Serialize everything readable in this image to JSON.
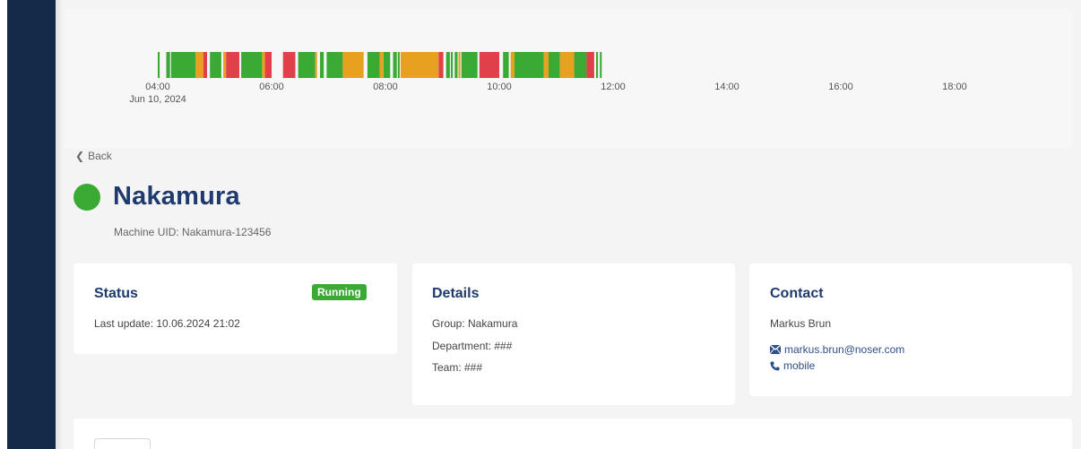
{
  "timeline": {
    "colors": {
      "green": "#3aaa35",
      "orange": "#e8a020",
      "red": "#e0404a"
    },
    "segments": [
      {
        "start": "04:00",
        "end": "04:02",
        "state": "green"
      },
      {
        "start": "04:09",
        "end": "04:13",
        "state": "green"
      },
      {
        "start": "04:14",
        "end": "04:40",
        "state": "green"
      },
      {
        "start": "04:40",
        "end": "04:48",
        "state": "orange"
      },
      {
        "start": "04:48",
        "end": "04:52",
        "state": "red"
      },
      {
        "start": "04:55",
        "end": "05:07",
        "state": "green"
      },
      {
        "start": "05:09",
        "end": "05:12",
        "state": "orange"
      },
      {
        "start": "05:12",
        "end": "05:26",
        "state": "red"
      },
      {
        "start": "05:28",
        "end": "05:50",
        "state": "green"
      },
      {
        "start": "05:50",
        "end": "05:53",
        "state": "orange"
      },
      {
        "start": "05:53",
        "end": "06:00",
        "state": "red"
      },
      {
        "start": "06:12",
        "end": "06:25",
        "state": "red"
      },
      {
        "start": "06:28",
        "end": "06:46",
        "state": "green"
      },
      {
        "start": "06:46",
        "end": "06:47",
        "state": "orange"
      },
      {
        "start": "06:51",
        "end": "06:55",
        "state": "green"
      },
      {
        "start": "06:58",
        "end": "07:15",
        "state": "green"
      },
      {
        "start": "07:15",
        "end": "07:37",
        "state": "orange"
      },
      {
        "start": "07:41",
        "end": "07:54",
        "state": "green"
      },
      {
        "start": "07:54",
        "end": "07:58",
        "state": "orange"
      },
      {
        "start": "07:58",
        "end": "08:05",
        "state": "green"
      },
      {
        "start": "08:08",
        "end": "08:12",
        "state": "green"
      },
      {
        "start": "08:13",
        "end": "08:15",
        "state": "green"
      },
      {
        "start": "08:16",
        "end": "08:56",
        "state": "orange"
      },
      {
        "start": "08:56",
        "end": "09:01",
        "state": "red"
      },
      {
        "start": "09:04",
        "end": "09:08",
        "state": "green"
      },
      {
        "start": "09:09",
        "end": "09:11",
        "state": "green"
      },
      {
        "start": "09:13",
        "end": "09:16",
        "state": "green"
      },
      {
        "start": "09:17",
        "end": "09:19",
        "state": "orange"
      },
      {
        "start": "09:20",
        "end": "09:37",
        "state": "green"
      },
      {
        "start": "09:39",
        "end": "10:00",
        "state": "red"
      },
      {
        "start": "10:04",
        "end": "10:10",
        "state": "green"
      },
      {
        "start": "10:12",
        "end": "10:16",
        "state": "orange"
      },
      {
        "start": "10:16",
        "end": "10:47",
        "state": "green"
      },
      {
        "start": "10:47",
        "end": "10:52",
        "state": "orange"
      },
      {
        "start": "10:52",
        "end": "11:04",
        "state": "green"
      },
      {
        "start": "11:04",
        "end": "11:19",
        "state": "orange"
      },
      {
        "start": "11:19",
        "end": "11:32",
        "state": "green"
      },
      {
        "start": "11:32",
        "end": "11:40",
        "state": "red"
      },
      {
        "start": "11:42",
        "end": "11:44",
        "state": "green"
      },
      {
        "start": "11:46",
        "end": "11:48",
        "state": "green"
      }
    ],
    "axis": [
      {
        "time": "04:00",
        "label": "04:00",
        "sub": "Jun 10, 2024"
      },
      {
        "time": "06:00",
        "label": "06:00"
      },
      {
        "time": "08:00",
        "label": "08:00"
      },
      {
        "time": "10:00",
        "label": "10:00"
      },
      {
        "time": "12:00",
        "label": "12:00"
      },
      {
        "time": "14:00",
        "label": "14:00"
      },
      {
        "time": "16:00",
        "label": "16:00"
      },
      {
        "time": "18:00",
        "label": "18:00"
      }
    ]
  },
  "back_label": "Back",
  "machine": {
    "name": "Nakamura",
    "uid_label": "Machine UID: Nakamura-123456",
    "status_color": "#3aaa35"
  },
  "status_card": {
    "title": "Status",
    "badge": "Running",
    "last_update": "Last update: 10.06.2024 21:02"
  },
  "details_card": {
    "title": "Details",
    "rows": [
      "Group: Nakamura",
      "Department: ###",
      "Team: ###"
    ]
  },
  "contact_card": {
    "title": "Contact",
    "name": "Markus Brun",
    "email": "markus.brun@noser.com",
    "phone": "mobile"
  }
}
